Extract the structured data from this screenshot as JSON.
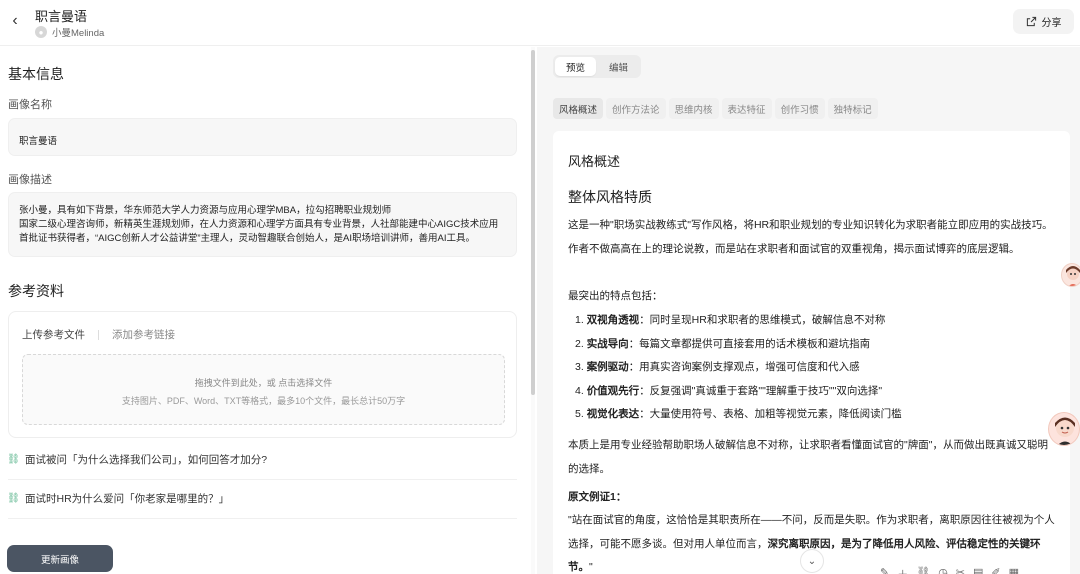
{
  "header": {
    "back_icon": "‹",
    "title": "职言曼语",
    "author_name": "小曼Melinda",
    "share_label": "分享"
  },
  "basic": {
    "section_title": "基本信息",
    "name_label": "画像名称",
    "name_value": "职言曼语",
    "desc_label": "画像描述",
    "desc_value": "张小曼，具有如下背景，华东师范大学人力资源与应用心理学MBA，拉勾招聘职业规划师\n国家二级心理咨询师，新精英生涯规划师，在人力资源和心理学方面具有专业背景，人社部能建中心AIGC技术应用首批证书获得者，“AIGC创新人才公益讲堂”主理人，灵动智趣联合创始人，是AI职场培训讲师，善用AI工具。"
  },
  "reference": {
    "section_title": "参考资料",
    "tab_upload": "上传参考文件",
    "tab_link": "添加参考链接",
    "drop_text": "拖拽文件到此处，或 点击选择文件",
    "drop_hint": "支持图片、PDF、Word、TXT等格式，最多10个文件，最长总计50万字",
    "links": [
      "面试被问「为什么选择我们公司」，如何回答才加分?",
      "面试时HR为什么爱问「你老家是哪里的？」"
    ]
  },
  "update_button": "更新画像",
  "preview": {
    "mode_tabs": [
      "预览",
      "编辑"
    ],
    "section_tabs": [
      "风格概述",
      "创作方法论",
      "思维内核",
      "表达特征",
      "创作习惯",
      "独特标记"
    ],
    "heading": "风格概述",
    "subheading": "整体风格特质",
    "para1": "这是一种\"职场实战教练式\"写作风格，将HR和职业规划的专业知识转化为求职者能立即应用的实战技巧。作者不做高高在上的理论说教，而是站在求职者和面试官的双重视角，揭示面试博弈的底层逻辑。",
    "para2": "最突出的特点包括：",
    "features": [
      {
        "num": "1.",
        "title": "双视角透视",
        "text": "：同时呈现HR和求职者的思维模式，破解信息不对称"
      },
      {
        "num": "2.",
        "title": "实战导向",
        "text": "：每篇文章都提供可直接套用的话术模板和避坑指南"
      },
      {
        "num": "3.",
        "title": "案例驱动",
        "text": "：用真实咨询案例支撑观点，增强可信度和代入感"
      },
      {
        "num": "4.",
        "title": "价值观先行",
        "text": "：反复强调\"真诚重于套路\"\"理解重于技巧\"\"双向选择\""
      },
      {
        "num": "5.",
        "title": "视觉化表达",
        "text": "：大量使用符号、表格、加粗等视觉元素，降低阅读门槛"
      }
    ],
    "para3": "本质上是用专业经验帮助职场人破解信息不对称，让求职者看懂面试官的\"牌面\"，从而做出既真诚又聪明的选择。",
    "example_title": "原文例证1：",
    "example_text_a": "\"站在面试官的角度，这恰恰是其职责所在——不问，反而是失职。作为求职者，离职原因往往被视为个人选择，可能不愿多谈。但对用人单位而言，",
    "example_text_bold": "深究离职原因，是为了降低用人风险、评估稳定性的关键环节。",
    "example_text_c": "\""
  },
  "colors": {
    "accent_link": "#5bb58d",
    "update_btn": "#4b5563"
  }
}
